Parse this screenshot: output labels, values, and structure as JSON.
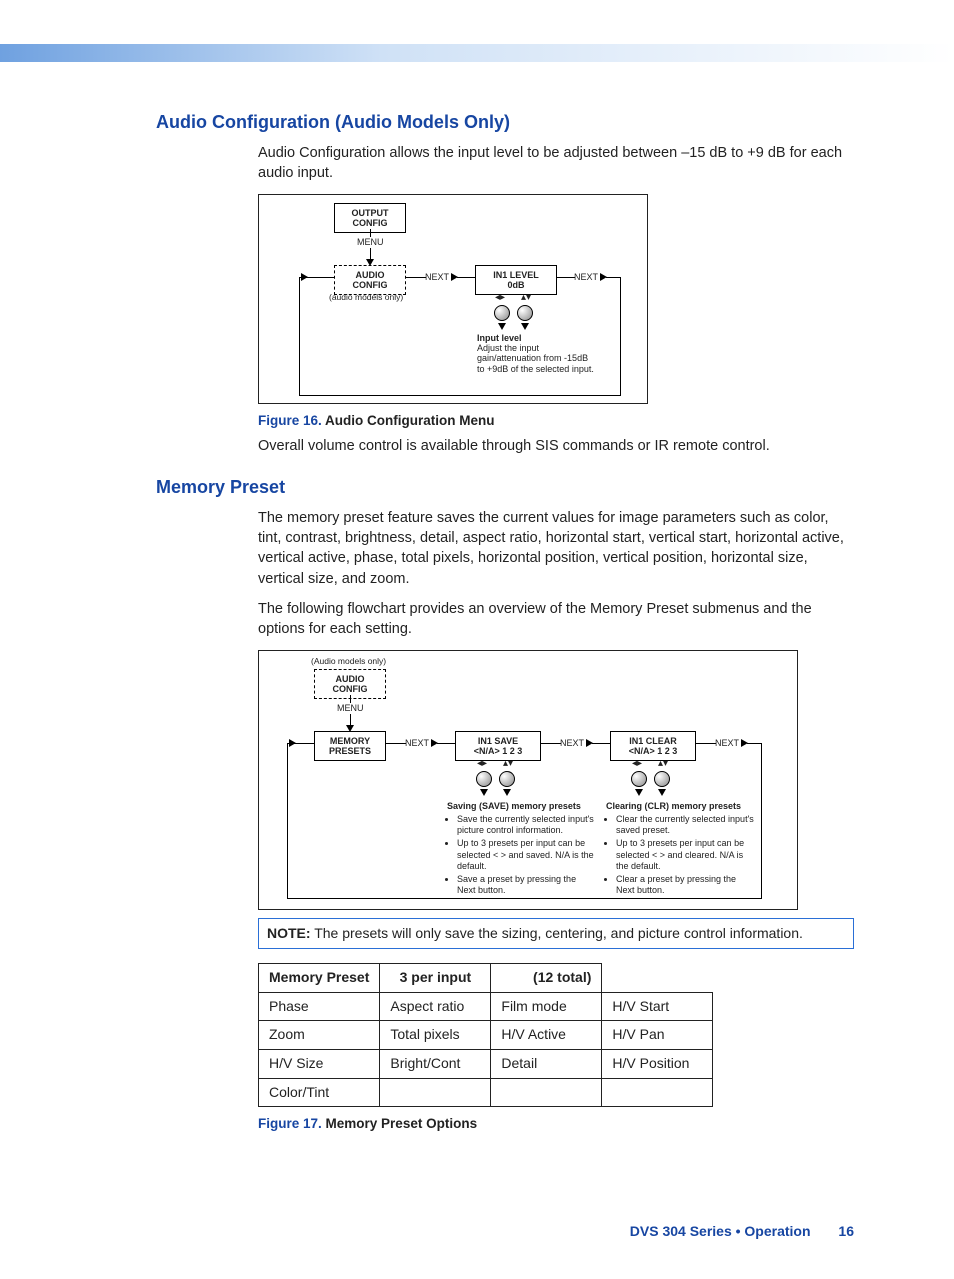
{
  "section1": {
    "heading": "Audio Configuration (Audio Models Only)",
    "para1": "Audio Configuration allows the input level to be adjusted between –15 dB to +9 dB for each audio input.",
    "diagram": {
      "box_output": "OUTPUT\nCONFIG",
      "menu_label": "MENU",
      "box_audio": "AUDIO\nCONFIG",
      "audio_note": "(audio models only)",
      "next1": "NEXT",
      "box_in1": "IN1  LEVEL\n0dB",
      "next2": "NEXT",
      "input_level_title": "Input level",
      "input_level_text": "Adjust the input gain/attenuation from -15dB to +9dB of the selected input."
    },
    "fig_num": "Figure 16.",
    "fig_title": " Audio Configuration Menu",
    "para2": "Overall volume control is available through SIS commands or IR remote control."
  },
  "section2": {
    "heading": "Memory Preset",
    "para1": "The memory preset feature saves the current values for image parameters such as color, tint, contrast, brightness, detail, aspect ratio, horizontal start, vertical start, horizontal active, vertical active, phase, total pixels, horizontal position, vertical position, horizontal size, vertical size, and zoom.",
    "para2": "The following flowchart provides an overview of the Memory Preset submenus and the options for each setting.",
    "diagram": {
      "audio_note": "(Audio models only)",
      "box_audio": "AUDIO\nCONFIG",
      "menu_label": "MENU",
      "box_memory": "MEMORY\nPRESETS",
      "next1": "NEXT",
      "box_save": "IN1  SAVE\n<N/A> 1 2 3",
      "next2": "NEXT",
      "box_clear": "IN1  CLEAR\n<N/A> 1 2 3",
      "next3": "NEXT",
      "save_title": "Saving (SAVE) memory presets",
      "save_b1": "Save the currently selected input's picture control information.",
      "save_b2": "Up to 3 presets per input can be selected < > and saved. N/A is the default.",
      "save_b3": "Save a preset by pressing the Next button.",
      "clear_title": "Clearing (CLR) memory presets",
      "clear_b1": "Clear the currently selected input's saved preset.",
      "clear_b2": "Up to 3 presets per input can be selected < > and cleared. N/A is the default.",
      "clear_b3": "Clear a preset by pressing the Next button."
    },
    "note_label": "NOTE:",
    "note_text": "  The presets will only save the sizing, centering, and picture control information.",
    "table": {
      "h1": "Memory Preset",
      "h2": "3 per input",
      "h3": "(12 total)",
      "h4": "",
      "r2c1": "Phase",
      "r2c2": "Aspect ratio",
      "r2c3": "Film mode",
      "r2c4": "H/V Start",
      "r3c1": "Zoom",
      "r3c2": "Total pixels",
      "r3c3": "H/V Active",
      "r3c4": "H/V Pan",
      "r4c1": "H/V Size",
      "r4c2": "Bright/Cont",
      "r4c3": "Detail",
      "r4c4": "H/V Position",
      "r5c1": "Color/Tint",
      "r5c2": "",
      "r5c3": "",
      "r5c4": ""
    },
    "fig_num": "Figure 17.",
    "fig_title": " Memory Preset Options"
  },
  "footer": {
    "text": "DVS 304 Series • Operation",
    "page": "16"
  }
}
